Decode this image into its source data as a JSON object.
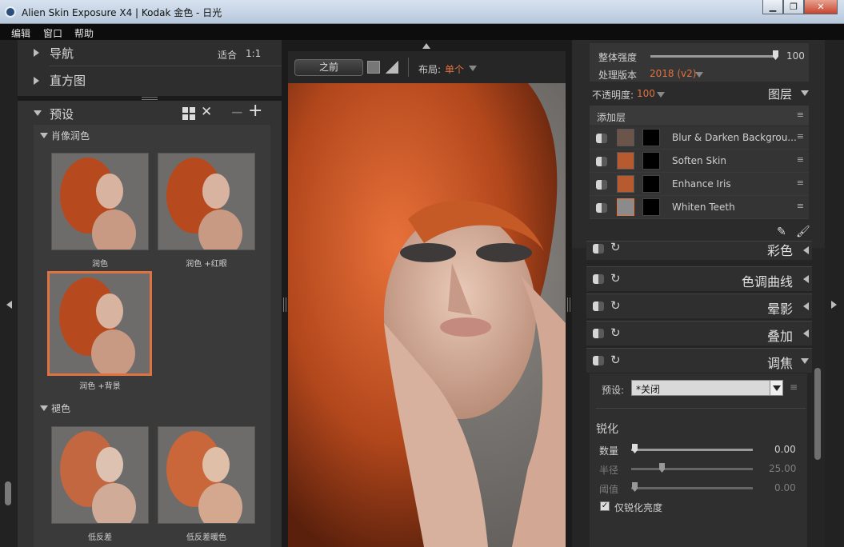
{
  "window": {
    "title": "Alien Skin Exposure X4 | Kodak 金色 - 日光"
  },
  "menu": [
    "编辑",
    "窗口",
    "帮助"
  ],
  "left": {
    "nav_label": "导航",
    "fit_label": "适合",
    "ratio_label": "1:1",
    "histogram_label": "直方图",
    "presets_label": "预设",
    "groups": [
      {
        "name": "肖像润色",
        "items": [
          "润色",
          "润色 +红眼",
          "润色 +背景"
        ]
      },
      {
        "name": "褪色",
        "items": [
          "低反差",
          "低反差暖色"
        ]
      }
    ]
  },
  "toolbar": {
    "before_label": "之前",
    "layout_label": "布局:",
    "layout_value": "单个"
  },
  "right": {
    "overall_strength_label": "整体强度",
    "overall_strength_value": "100",
    "process_version_label": "处理版本",
    "process_version_value": "2018 (v2)",
    "opacity_label": "不透明度:",
    "opacity_value": "100",
    "layers_label": "图层",
    "add_layer_label": "添加层",
    "layers": [
      "Blur & Darken Backgrou...",
      "Soften Skin",
      "Enhance Iris",
      "Whiten Teeth"
    ],
    "effects": [
      "彩色",
      "色调曲线",
      "晕影",
      "叠加",
      "调焦"
    ],
    "focus": {
      "preset_label": "预设:",
      "preset_value": "*关闭",
      "sharpen_label": "锐化",
      "amount_label": "数量",
      "amount_value": "0.00",
      "radius_label": "半径",
      "radius_value": "25.00",
      "threshold_label": "阈值",
      "threshold_value": "0.00",
      "luminance_only_label": "仅锐化亮度"
    }
  },
  "colors": {
    "accent": "#e0723f",
    "panel": "#2e2e2e",
    "bg": "#1b1b1b"
  }
}
